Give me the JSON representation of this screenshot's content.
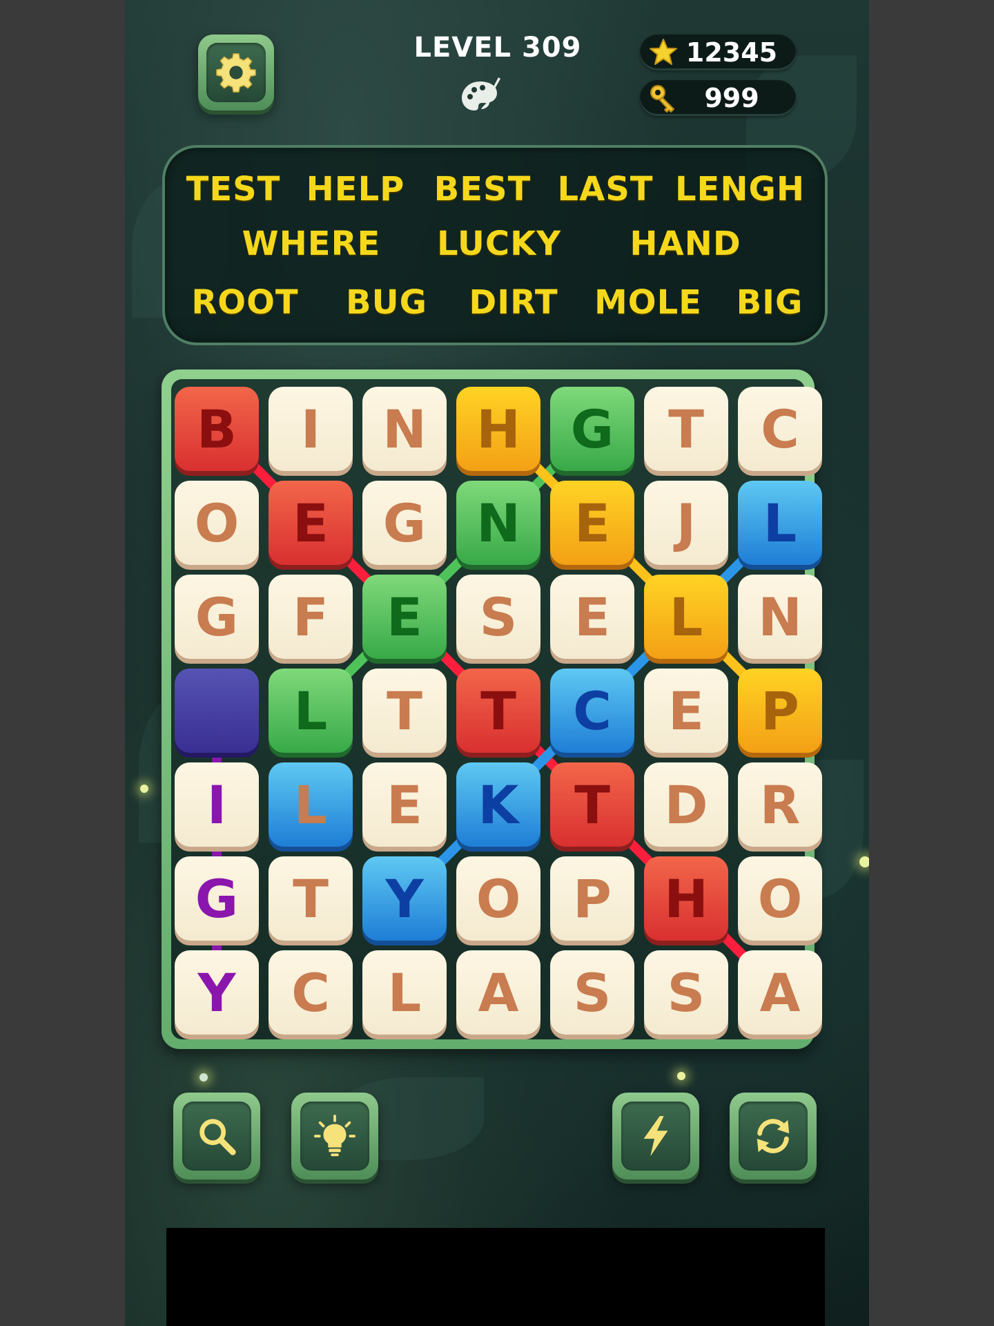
{
  "header": {
    "level_title": "LEVEL 309",
    "stars": "12345",
    "keys": "999"
  },
  "icons": {
    "settings": "gear-icon",
    "theme": "palette-brush-icon",
    "star": "star-icon",
    "key": "key-icon",
    "search": "magnifier-icon",
    "hint": "lightbulb-icon",
    "boost": "lightning-icon",
    "shuffle": "refresh-icon"
  },
  "colors": {
    "word_text": "#f5d81c",
    "red": "#d93030",
    "green": "#38a948",
    "orange": "#f3a015",
    "blue": "#1e7ed6",
    "purple": "#3a2f92",
    "cream": "#f4ead0"
  },
  "words": [
    [
      "TEST",
      "HELP",
      "BEST",
      "LAST",
      "LENGH"
    ],
    [
      "WHERE",
      "LUCKY",
      "HAND"
    ],
    [
      "ROOT",
      "BUG",
      "DIRT",
      "MOLE",
      "BIG"
    ]
  ],
  "grid": [
    [
      {
        "l": "B",
        "c": "red"
      },
      {
        "l": "I",
        "c": "cream"
      },
      {
        "l": "N",
        "c": "cream"
      },
      {
        "l": "H",
        "c": "orange"
      },
      {
        "l": "G",
        "c": "green"
      },
      {
        "l": "T",
        "c": "cream"
      },
      {
        "l": "C",
        "c": "cream"
      }
    ],
    [
      {
        "l": "O",
        "c": "cream"
      },
      {
        "l": "E",
        "c": "red"
      },
      {
        "l": "G",
        "c": "cream"
      },
      {
        "l": "N",
        "c": "green"
      },
      {
        "l": "E",
        "c": "orange"
      },
      {
        "l": "J",
        "c": "cream"
      },
      {
        "l": "L",
        "c": "blue"
      }
    ],
    [
      {
        "l": "G",
        "c": "cream"
      },
      {
        "l": "F",
        "c": "cream"
      },
      {
        "l": "E",
        "c": "green"
      },
      {
        "l": "S",
        "c": "cream"
      },
      {
        "l": "E",
        "c": "cream"
      },
      {
        "l": "L",
        "c": "orange"
      },
      {
        "l": "N",
        "c": "cream"
      }
    ],
    [
      {
        "l": "",
        "c": "purple"
      },
      {
        "l": "L",
        "c": "green"
      },
      {
        "l": "T",
        "c": "cream"
      },
      {
        "l": "T",
        "c": "red"
      },
      {
        "l": "C",
        "c": "blue"
      },
      {
        "l": "E",
        "c": "cream"
      },
      {
        "l": "P",
        "c": "orange"
      }
    ],
    [
      {
        "l": "I",
        "c": "cream",
        "lc": "purple"
      },
      {
        "l": "L",
        "c": "blue",
        "lc": "orange"
      },
      {
        "l": "E",
        "c": "cream"
      },
      {
        "l": "K",
        "c": "blue"
      },
      {
        "l": "T",
        "c": "red"
      },
      {
        "l": "D",
        "c": "cream"
      },
      {
        "l": "R",
        "c": "cream"
      }
    ],
    [
      {
        "l": "G",
        "c": "cream",
        "lc": "purple"
      },
      {
        "l": "T",
        "c": "cream"
      },
      {
        "l": "Y",
        "c": "blue"
      },
      {
        "l": "O",
        "c": "cream"
      },
      {
        "l": "P",
        "c": "cream"
      },
      {
        "l": "H",
        "c": "red"
      },
      {
        "l": "O",
        "c": "cream"
      }
    ],
    [
      {
        "l": "Y",
        "c": "cream",
        "lc": "purple"
      },
      {
        "l": "C",
        "c": "cream"
      },
      {
        "l": "L",
        "c": "cream"
      },
      {
        "l": "A",
        "c": "cream"
      },
      {
        "l": "S",
        "c": "cream"
      },
      {
        "l": "S",
        "c": "cream"
      },
      {
        "l": "A",
        "c": "cream"
      }
    ]
  ],
  "paths": [
    {
      "color": "#ff1f3d",
      "cells": [
        [
          0,
          0
        ],
        [
          1,
          1
        ],
        [
          2,
          2
        ],
        [
          3,
          3
        ],
        [
          4,
          4
        ],
        [
          5,
          5
        ],
        [
          6,
          6
        ]
      ]
    },
    {
      "color": "#4fc35a",
      "cells": [
        [
          0,
          4
        ],
        [
          1,
          3
        ],
        [
          2,
          2
        ],
        [
          3,
          1
        ]
      ]
    },
    {
      "color": "#ffc21c",
      "cells": [
        [
          0,
          3
        ],
        [
          1,
          4
        ],
        [
          2,
          5
        ],
        [
          3,
          6
        ]
      ]
    },
    {
      "color": "#2b96e8",
      "cells": [
        [
          1,
          6
        ],
        [
          2,
          5
        ],
        [
          3,
          4
        ],
        [
          4,
          3
        ],
        [
          5,
          2
        ]
      ]
    },
    {
      "color": "#8a16ad",
      "cells": [
        [
          3,
          0
        ],
        [
          4,
          0
        ],
        [
          5,
          0
        ],
        [
          6,
          0
        ]
      ]
    }
  ]
}
